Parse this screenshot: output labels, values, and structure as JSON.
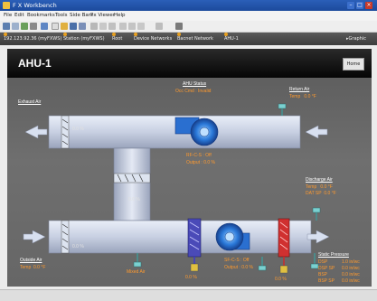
{
  "window": {
    "title": "F X Workbench"
  },
  "menu": [
    "File",
    "Edit",
    "Bookmarks",
    "Tools",
    "Side Bars",
    "Px Viewer",
    "Help"
  ],
  "nav": {
    "crumbs": [
      "192.123.92.36 (myFXWS)",
      "Station (myFXWS)",
      "Root",
      "Device Networks",
      "Bacnet Network",
      "AHU-1"
    ],
    "right": "Graphic"
  },
  "hmi": {
    "unit_title": "AHU-1",
    "home_button": "Home",
    "status": {
      "label": "AHU Status",
      "text": "Occ Cmd : Invalid"
    },
    "exhaust_air": {
      "label": "Exhaust Air"
    },
    "return_air": {
      "label": "Return Air",
      "temp_label": "Temp",
      "temp": "0.0 °F"
    },
    "exhaust_damper": {
      "value": "0.0 %"
    },
    "mixed_damper": {
      "value": "0.0 %"
    },
    "outside_damper": {
      "value": "0.0 %"
    },
    "return_fan": {
      "status_label": "RF-C-S :",
      "status": "Off",
      "output_label": "Output :",
      "output": "0.0 %"
    },
    "supply_fan": {
      "status_label": "SF-C-S :",
      "status": "Off",
      "output_label": "Output :",
      "output": "0.0 %"
    },
    "outside_air": {
      "label": "Outside Air",
      "temp_label": "Temp",
      "temp": "0.0 °F"
    },
    "mixed_air": {
      "label": "Mixed Air"
    },
    "coil_valve": {
      "value": "0.0 %"
    },
    "heat_valve": {
      "value": "0.0 %"
    },
    "discharge_air": {
      "label": "Discharge Air",
      "temp_label": "Temp",
      "temp": "0.0 °F",
      "sp_label": "DAT SP",
      "sp": "0.0 °F"
    },
    "static_pressure": {
      "label": "Static Pressure",
      "rows": [
        {
          "name": "DSP",
          "value": "1.0 in/wc"
        },
        {
          "name": "DSP SP",
          "value": "0.0 in/wc"
        },
        {
          "name": "BSP",
          "value": "0.0 in/wc"
        },
        {
          "name": "BSP SP",
          "value": "0.0 in/wc"
        }
      ]
    }
  },
  "colors": {
    "titlebar": "#1c4a9c",
    "value_text": "#ff9a2e",
    "duct": "#cfd6e6",
    "fan": "#2a6fd0",
    "heating_coil": "#d03030"
  }
}
